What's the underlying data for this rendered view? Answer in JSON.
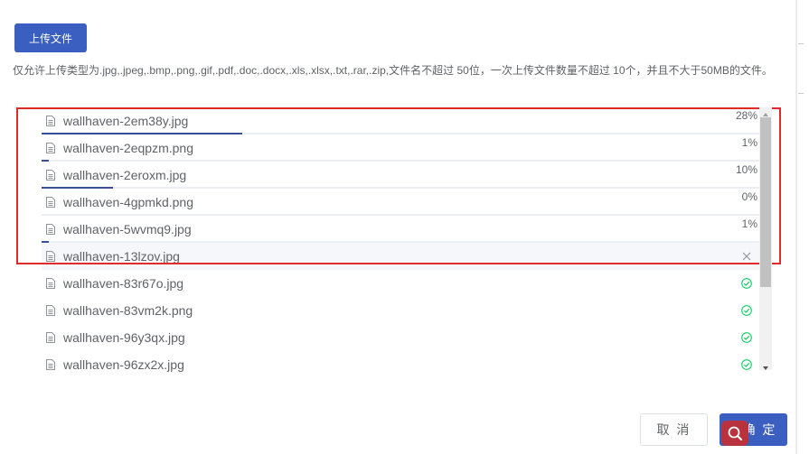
{
  "toolbar": {
    "upload_label": "上传文件"
  },
  "hint": "仅允许上传类型为.jpg,.jpeg,.bmp,.png,.gif,.pdf,.doc,.docx,.xls,.xlsx,.txt,.rar,.zip,文件名不超过 50位，一次上传文件数量不超过 10个，并且不大于50MB的文件。",
  "files": [
    {
      "name": "wallhaven-2em38y.jpg",
      "status": "uploading",
      "percent_label": "28%",
      "progress": 0.28
    },
    {
      "name": "wallhaven-2eqpzm.png",
      "status": "uploading",
      "percent_label": "1%",
      "progress": 0.01
    },
    {
      "name": "wallhaven-2eroxm.jpg",
      "status": "uploading",
      "percent_label": "10%",
      "progress": 0.1
    },
    {
      "name": "wallhaven-4gpmkd.png",
      "status": "uploading",
      "percent_label": "0%",
      "progress": 0.0
    },
    {
      "name": "wallhaven-5wvmq9.jpg",
      "status": "uploading",
      "percent_label": "1%",
      "progress": 0.01
    },
    {
      "name": "wallhaven-13lzov.jpg",
      "status": "hover",
      "icon": "close-icon"
    },
    {
      "name": "wallhaven-83r67o.jpg",
      "status": "success",
      "icon": "check-circle-icon"
    },
    {
      "name": "wallhaven-83vm2k.png",
      "status": "success",
      "icon": "check-circle-icon"
    },
    {
      "name": "wallhaven-96y3qx.jpg",
      "status": "success",
      "icon": "check-circle-icon"
    },
    {
      "name": "wallhaven-96zx2x.jpg",
      "status": "success",
      "icon": "check-circle-icon"
    }
  ],
  "footer": {
    "cancel_label": "取 消",
    "confirm_label": "确 定"
  },
  "colors": {
    "primary": "#3a5fc1",
    "progress": "#3a5096",
    "success": "#13ce66",
    "highlight": "#e02b2b"
  }
}
